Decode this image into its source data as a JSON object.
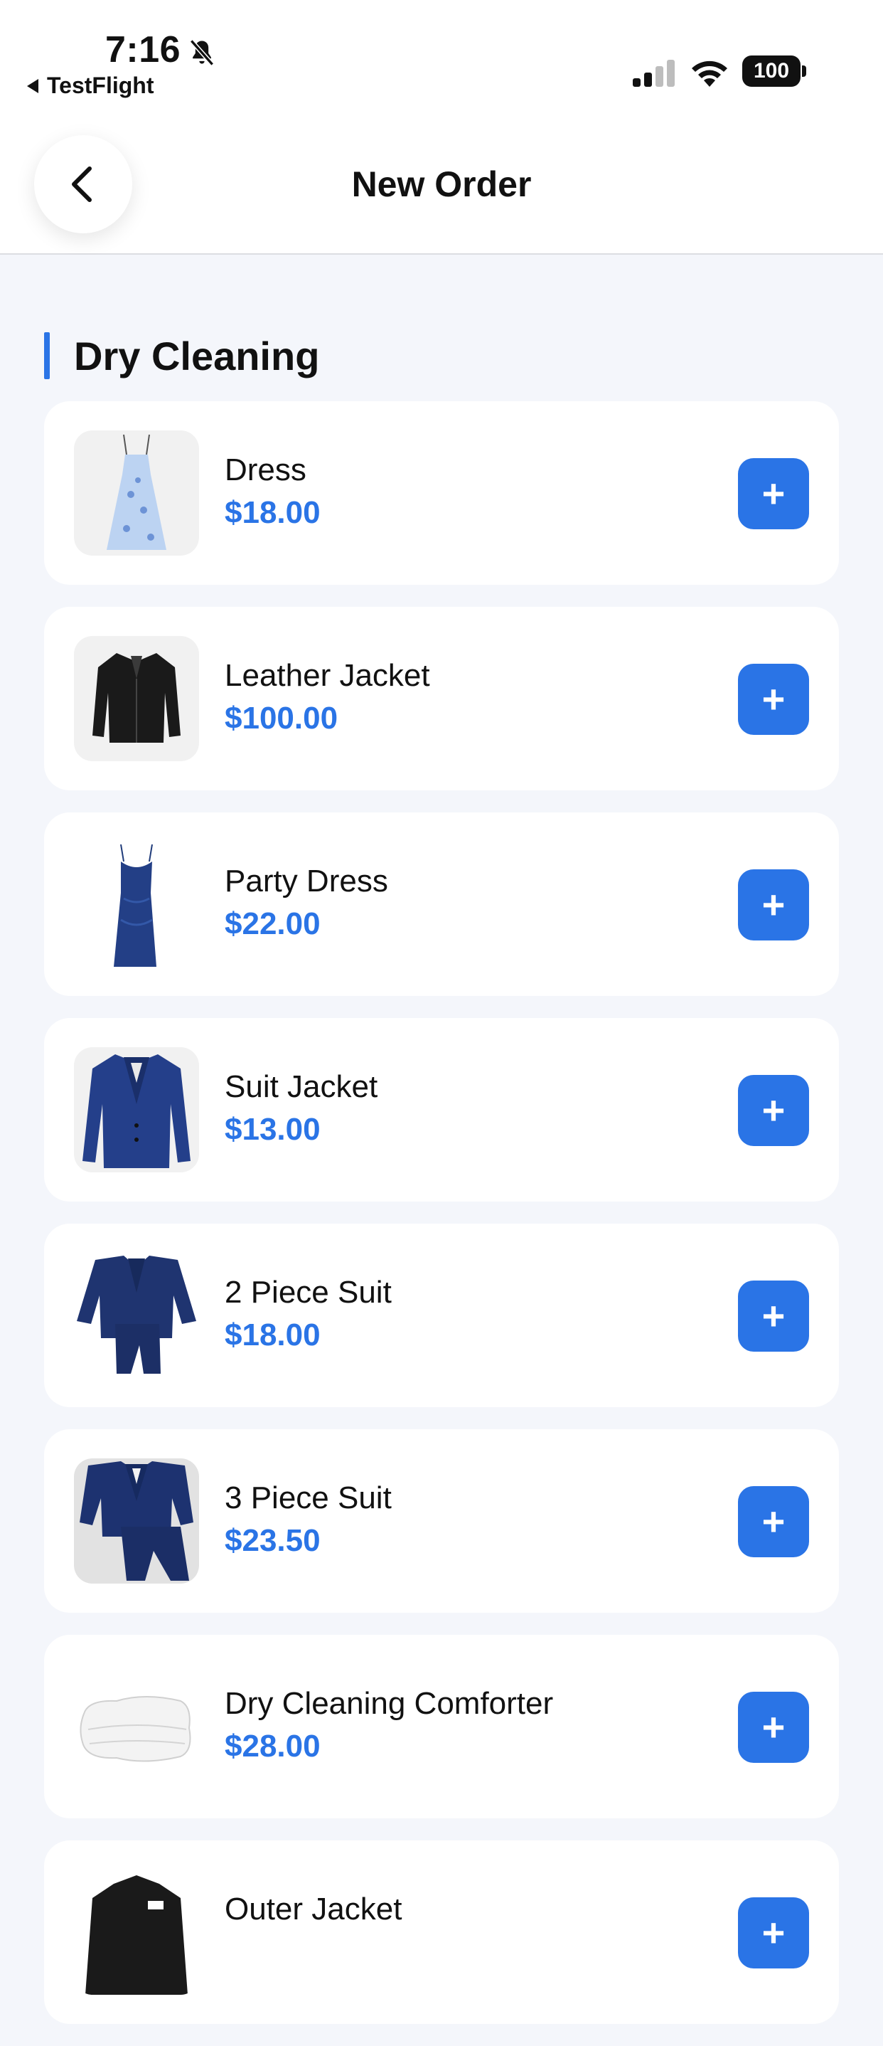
{
  "status_bar": {
    "time": "7:16",
    "back_app_label": "TestFlight",
    "battery_level": "100",
    "icons": [
      "bell-slash-icon",
      "signal-icon",
      "wifi-icon",
      "battery-icon"
    ]
  },
  "nav": {
    "title": "New Order",
    "back_icon": "chevron-left-icon"
  },
  "section": {
    "title": "Dry Cleaning",
    "accent_color": "#2a74e6"
  },
  "items": [
    {
      "name": "Dress",
      "price": "$18.00",
      "add_label": "+"
    },
    {
      "name": "Leather Jacket",
      "price": "$100.00",
      "add_label": "+"
    },
    {
      "name": "Party Dress",
      "price": "$22.00",
      "add_label": "+"
    },
    {
      "name": "Suit Jacket",
      "price": "$13.00",
      "add_label": "+"
    },
    {
      "name": "2 Piece Suit",
      "price": "$18.00",
      "add_label": "+"
    },
    {
      "name": "3 Piece Suit",
      "price": "$23.50",
      "add_label": "+"
    },
    {
      "name": "Dry Cleaning Comforter",
      "price": "$28.00",
      "add_label": "+"
    },
    {
      "name": "Outer Jacket",
      "price": "",
      "add_label": "+"
    }
  ],
  "colors": {
    "accent": "#2a74e6",
    "background": "#f4f6fb",
    "card": "#ffffff"
  }
}
